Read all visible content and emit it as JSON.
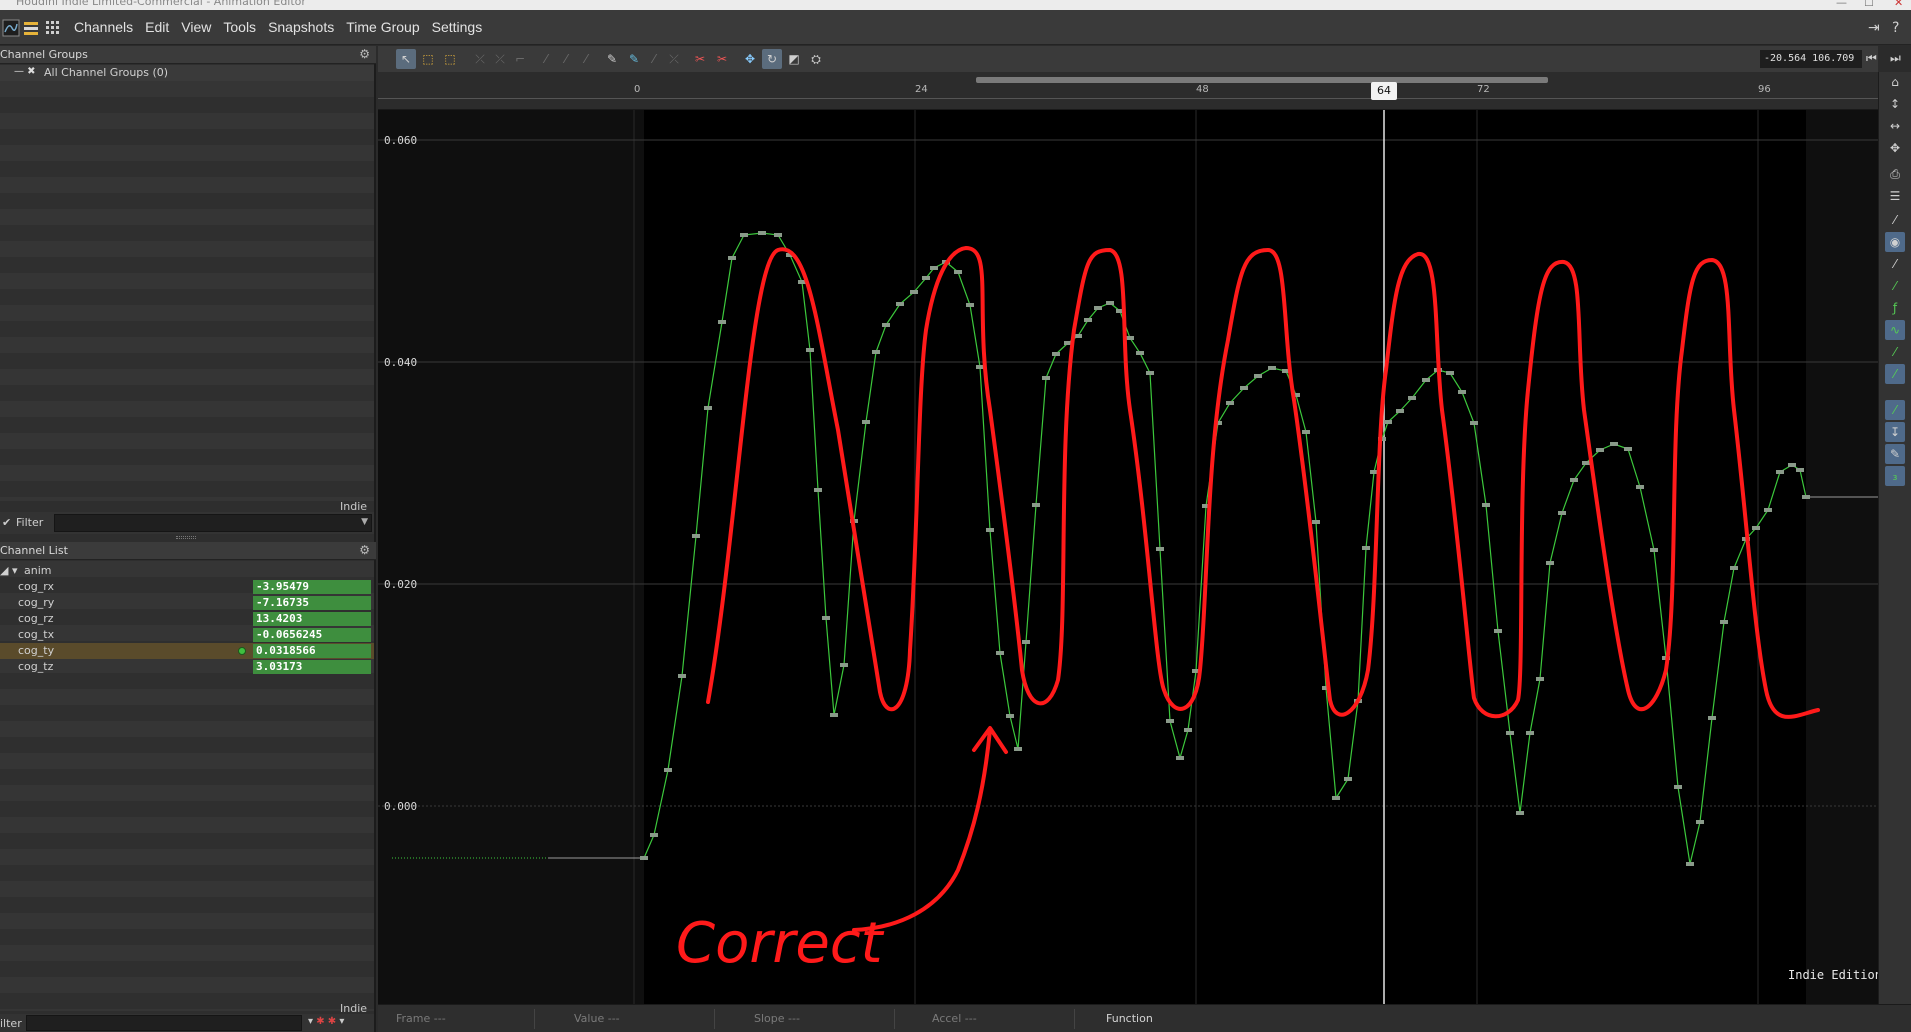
{
  "window": {
    "title": "Houdini Indie Limited-Commercial - Animation Editor"
  },
  "menubar": {
    "items": [
      "Channels",
      "Edit",
      "View",
      "Tools",
      "Snapshots",
      "Time Group",
      "Settings"
    ]
  },
  "channel_groups": {
    "title": "Channel Groups",
    "all_groups_label": "All Channel Groups (0)",
    "indie_tag": "Indie",
    "filter_label": "Filter",
    "filter_value": ""
  },
  "channel_list": {
    "title": "Channel List",
    "root_label": "anim",
    "channels": [
      {
        "name": "cog_rx",
        "value": "-3.95479",
        "selected": false
      },
      {
        "name": "cog_ry",
        "value": "-7.16735",
        "selected": false
      },
      {
        "name": "cog_rz",
        "value": "13.4203",
        "selected": false
      },
      {
        "name": "cog_tx",
        "value": "-0.0656245",
        "selected": false
      },
      {
        "name": "cog_ty",
        "value": "0.0318566",
        "selected": true
      },
      {
        "name": "cog_tz",
        "value": "3.03173",
        "selected": false
      }
    ],
    "indie_tag": "Indie",
    "filter_label": "ilter"
  },
  "toolbar": {
    "range_value": "-20.564 106.709",
    "icons": [
      "select-icon",
      "box-select-icon",
      "box-select-alt-icon",
      "tangent-tool-icon",
      "tangent-tool-icon",
      "tangent-tool-icon",
      "tangent-tool-icon",
      "tangent-tool-icon",
      "tangent-tool-icon",
      "pen-icon",
      "add-key-icon",
      "delete-key-icon",
      "cut-icon",
      "cut-alt-icon",
      "move-icon",
      "rotate-icon",
      "scale-icon",
      "camera-icon"
    ]
  },
  "timeline": {
    "ticks": [
      "0",
      "24",
      "48",
      "72",
      "96"
    ],
    "current_frame": "64"
  },
  "graph": {
    "y_labels": [
      "0.060",
      "0.040",
      "0.020",
      "0.000"
    ],
    "annotation_text": "Correct",
    "watermark": "Indie Edition",
    "colors": {
      "curve": "#3cc83c",
      "annotation": "#ff1a1a",
      "background": "#0a0a0a",
      "active_range": "#000000"
    }
  },
  "statusbar": {
    "frame_label": "Frame",
    "frame_value": "---",
    "value_label": "Value",
    "value_value": "---",
    "slope_label": "Slope",
    "slope_value": "---",
    "accel_label": "Accel",
    "accel_value": "---",
    "function_label": "Function"
  }
}
